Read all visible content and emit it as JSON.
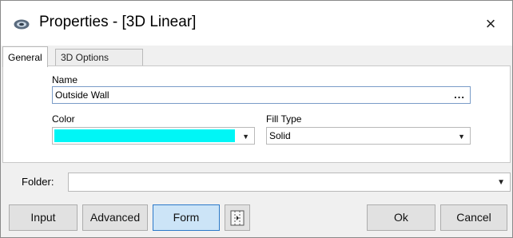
{
  "window": {
    "title": "Properties - [3D Linear]",
    "close_glyph": "×"
  },
  "tabs": [
    {
      "label": "General",
      "active": true
    },
    {
      "label": "3D Options",
      "active": false
    }
  ],
  "general": {
    "name_label": "Name",
    "name_value": "Outside Wall",
    "name_browse": "...",
    "color_label": "Color",
    "color_value": "#00f6f6",
    "fill_type_label": "Fill Type",
    "fill_type_value": "Solid"
  },
  "folder": {
    "label": "Folder:",
    "value": ""
  },
  "buttons": {
    "input": "Input",
    "advanced": "Advanced",
    "form": "Form",
    "ok": "Ok",
    "cancel": "Cancel"
  },
  "icons": {
    "app": "app-icon",
    "dropdown": "▼",
    "panel_toggle": "panel-toggle-icon"
  }
}
